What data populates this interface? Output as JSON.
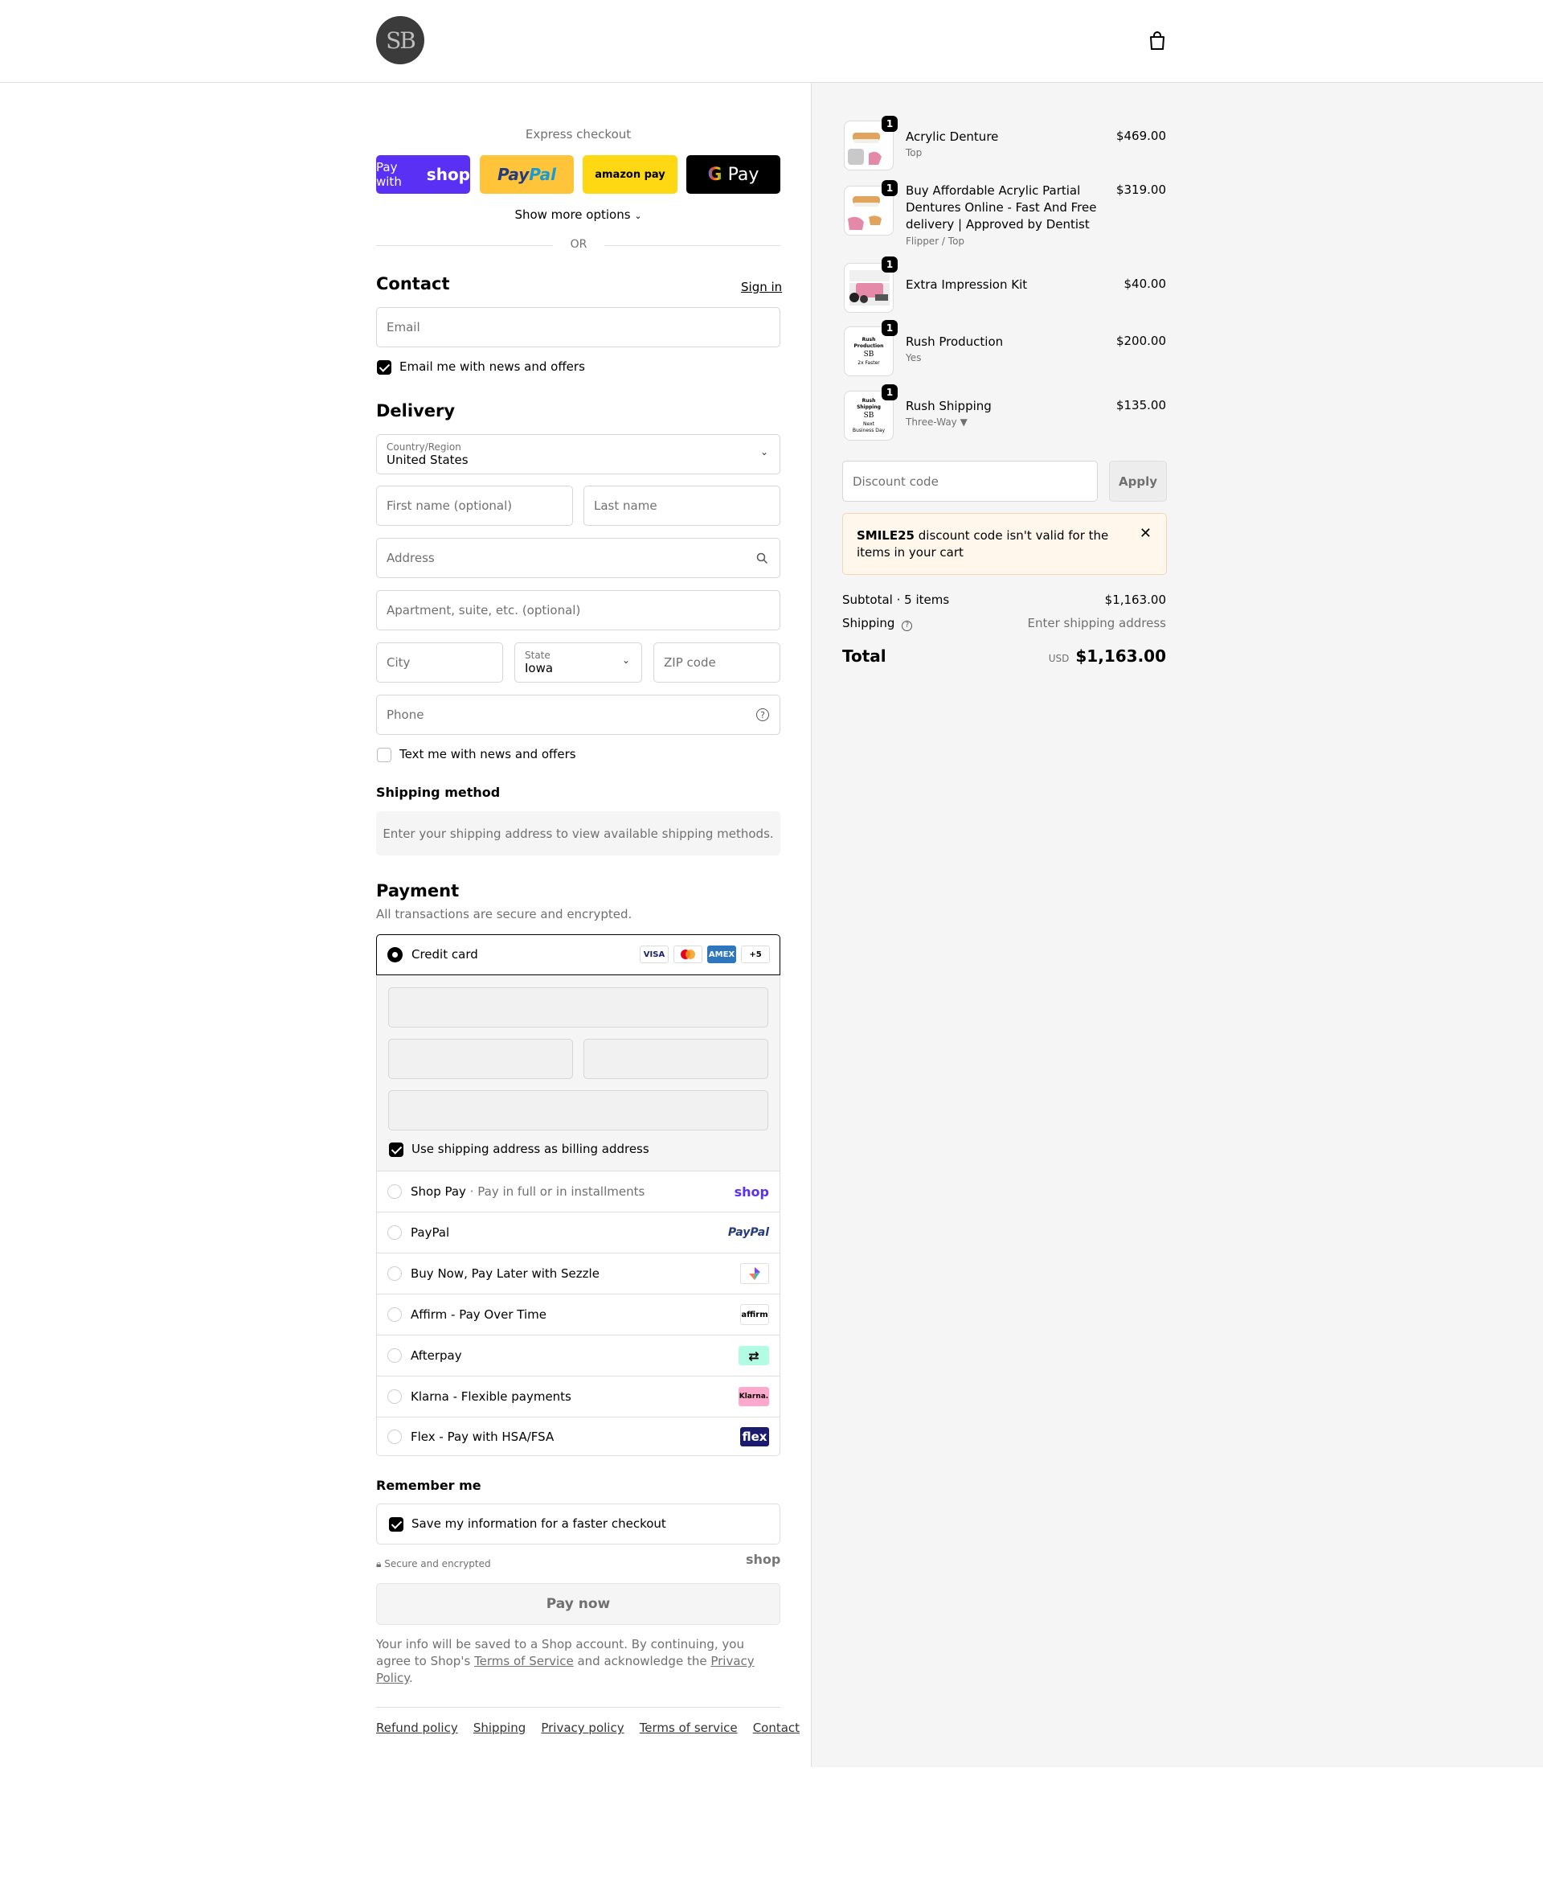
{
  "header": {
    "logo_text": "SB",
    "cart_icon": "shopping-bag-icon"
  },
  "express": {
    "label": "Express checkout",
    "buttons": {
      "shop_prefix": "Pay with",
      "shop_brand": "shop",
      "paypal_a": "Pay",
      "paypal_b": "Pal",
      "amazon": "amazon pay",
      "gpay": "Pay"
    },
    "more_options": "Show more options",
    "or": "OR"
  },
  "contact": {
    "title": "Contact",
    "sign_in": "Sign in",
    "email_placeholder": "Email",
    "news_checkbox": "Email me with news and offers"
  },
  "delivery": {
    "title": "Delivery",
    "country_label": "Country/Region",
    "country_value": "United States",
    "first_name": "First name (optional)",
    "last_name": "Last name",
    "address": "Address",
    "apartment": "Apartment, suite, etc. (optional)",
    "city": "City",
    "state_label": "State",
    "state_value": "Iowa",
    "zip": "ZIP code",
    "phone": "Phone",
    "text_checkbox": "Text me with news and offers"
  },
  "shipping_method": {
    "title": "Shipping method",
    "message": "Enter your shipping address to view available shipping methods."
  },
  "payment": {
    "title": "Payment",
    "subtitle": "All transactions are secure and encrypted.",
    "credit_card": "Credit card",
    "card_brands": [
      "VISA",
      "MC",
      "AMEX",
      "+5"
    ],
    "billing_checkbox": "Use shipping address as billing address",
    "options": [
      {
        "label": "Shop Pay",
        "sub": "Pay in full or in installments",
        "logo": "shop"
      },
      {
        "label": "PayPal",
        "sub": "",
        "logo": "PayPal"
      },
      {
        "label": "Buy Now, Pay Later with Sezzle",
        "sub": "",
        "logo": "sezzle"
      },
      {
        "label": "Affirm - Pay Over Time",
        "sub": "",
        "logo": "affirm"
      },
      {
        "label": "Afterpay",
        "sub": "",
        "logo": "afterpay"
      },
      {
        "label": "Klarna - Flexible payments",
        "sub": "",
        "logo": "Klarna."
      },
      {
        "label": "Flex - Pay with HSA/FSA",
        "sub": "",
        "logo": "flex"
      }
    ]
  },
  "remember": {
    "title": "Remember me",
    "save_checkbox": "Save my information for a faster checkout",
    "secure": "Secure and encrypted",
    "shop_brand": "shop"
  },
  "pay_now": "Pay now",
  "legal": {
    "text_1": "Your info will be saved to a Shop account. By continuing, you agree to Shop's",
    "terms": "Terms of Service",
    "text_2": "and acknowledge the",
    "privacy": "Privacy Policy",
    "text_3": "."
  },
  "footer_links": [
    "Refund policy",
    "Shipping",
    "Privacy policy",
    "Terms of service",
    "Contact"
  ],
  "cart": {
    "items": [
      {
        "name": "Acrylic Denture",
        "variant": "Top",
        "price": "$469.00",
        "qty": "1"
      },
      {
        "name": "Buy Affordable Acrylic Partial Dentures Online - Fast And Free delivery | Approved by Dentist",
        "variant": "Flipper / Top",
        "price": "$319.00",
        "qty": "1"
      },
      {
        "name": "Extra Impression Kit",
        "variant": "",
        "price": "$40.00",
        "qty": "1"
      },
      {
        "name": "Rush Production",
        "variant": "Yes",
        "price": "$200.00",
        "qty": "1"
      },
      {
        "name": "Rush Shipping",
        "variant": "Three-Way ▼",
        "price": "$135.00",
        "qty": "1"
      }
    ],
    "thumb_text": {
      "rush_production": [
        "Rush",
        "Production",
        "SB",
        "2x Faster"
      ],
      "rush_shipping": [
        "Rush",
        "Shipping",
        "SB",
        "Next",
        "Business Day"
      ]
    },
    "discount_placeholder": "Discount code",
    "apply": "Apply",
    "alert_code": "SMILE25",
    "alert_text": "discount code isn't valid for the items in your cart",
    "subtotal_label": "Subtotal · 5 items",
    "subtotal_value": "$1,163.00",
    "shipping_label": "Shipping",
    "shipping_value": "Enter shipping address",
    "total_label": "Total",
    "currency": "USD",
    "total_value": "$1,163.00"
  }
}
